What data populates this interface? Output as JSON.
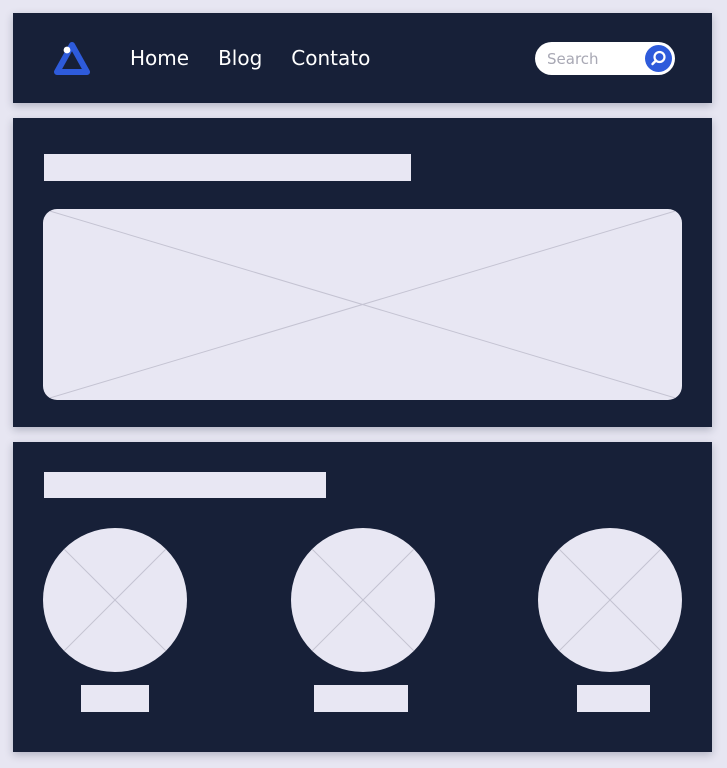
{
  "navbar": {
    "logo_icon": "triangle-logo-icon",
    "links": [
      {
        "label": "Home"
      },
      {
        "label": "Blog"
      },
      {
        "label": "Contato"
      }
    ],
    "search": {
      "placeholder": "Search",
      "value": "",
      "button_icon": "search-icon"
    }
  },
  "colors": {
    "background": "#e7e6f2",
    "panel": "#172038",
    "placeholder": "#e8e7f3",
    "accent": "#2e5bdb"
  }
}
